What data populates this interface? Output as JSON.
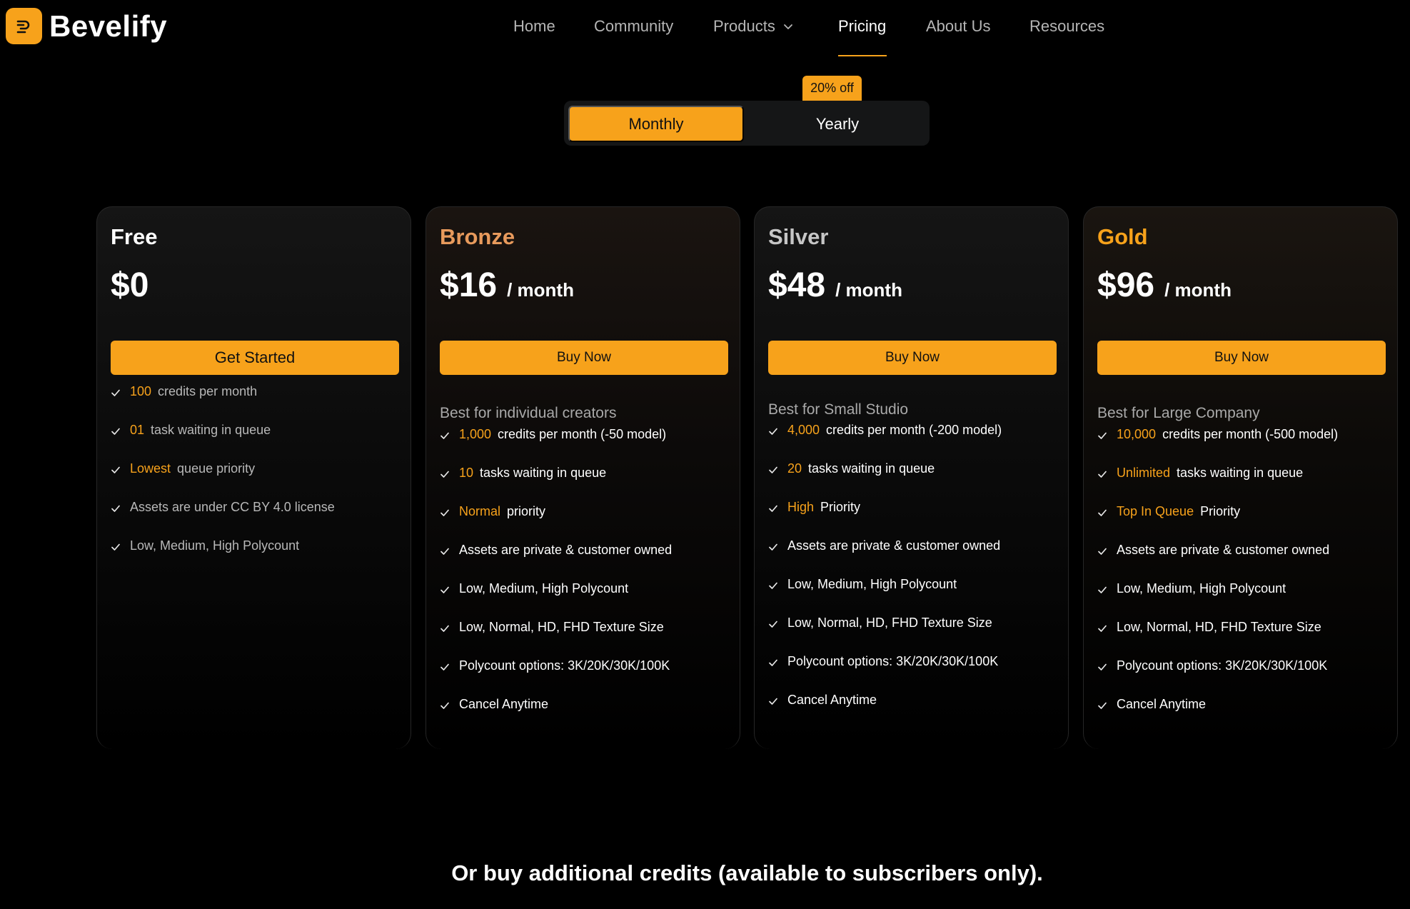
{
  "brand": {
    "name": "Bevelify",
    "accent": "#f7a21b"
  },
  "nav": {
    "items": [
      {
        "label": "Home"
      },
      {
        "label": "Community"
      },
      {
        "label": "Products"
      },
      {
        "label": "Pricing",
        "active": true
      },
      {
        "label": "About Us"
      },
      {
        "label": "Resources"
      }
    ]
  },
  "billing": {
    "discount_badge": "20% off",
    "monthly_label": "Monthly",
    "yearly_label": "Yearly",
    "selected": "Monthly"
  },
  "plans": [
    {
      "name": "Free",
      "name_color": "#ffffff",
      "price": "$0",
      "period": "",
      "button": "Get Started",
      "subtitle": "",
      "features": [
        {
          "highlight": "100",
          "text": "credits per month"
        },
        {
          "highlight": "01",
          "text": "task waiting in queue"
        },
        {
          "highlight": "Lowest",
          "text": "queue priority"
        },
        {
          "highlight": "",
          "text": "Assets are under CC BY 4.0 license"
        },
        {
          "highlight": "",
          "text": "Low, Medium, High Polycount"
        }
      ]
    },
    {
      "name": "Bronze",
      "name_color": "#e89a5c",
      "price": "$16",
      "period": "/ month",
      "button": "Buy Now",
      "subtitle": "Best for individual creators",
      "features": [
        {
          "highlight": "1,000",
          "text": "credits per month (-50 model)"
        },
        {
          "highlight": "10",
          "text": "tasks waiting in queue"
        },
        {
          "highlight": "Normal",
          "text": "priority"
        },
        {
          "highlight": "",
          "text": "Assets are private & customer owned"
        },
        {
          "highlight": "",
          "text": "Low, Medium, High Polycount"
        },
        {
          "highlight": "",
          "text": "Low, Normal, HD, FHD Texture Size"
        },
        {
          "highlight": "",
          "text": "Polycount options: 3K/20K/30K/100K"
        },
        {
          "highlight": "",
          "text": "Cancel Anytime"
        }
      ]
    },
    {
      "name": "Silver",
      "name_color": "#c6c6c6",
      "price": "$48",
      "period": "/ month",
      "button": "Buy Now",
      "subtitle": "Best for Small Studio",
      "features": [
        {
          "highlight": "4,000",
          "text": "credits per month (-200 model)"
        },
        {
          "highlight": "20",
          "text": "tasks waiting in queue"
        },
        {
          "highlight": "High",
          "text": "Priority"
        },
        {
          "highlight": "",
          "text": "Assets are private & customer owned"
        },
        {
          "highlight": "",
          "text": "Low, Medium, High Polycount"
        },
        {
          "highlight": "",
          "text": "Low, Normal, HD, FHD Texture Size"
        },
        {
          "highlight": "",
          "text": "Polycount options: 3K/20K/30K/100K"
        },
        {
          "highlight": "",
          "text": "Cancel Anytime"
        }
      ]
    },
    {
      "name": "Gold",
      "name_color": "#f7a21b",
      "price": "$96",
      "period": "/ month",
      "button": "Buy Now",
      "subtitle": "Best for Large Company",
      "features": [
        {
          "highlight": "10,000",
          "text": "credits per month (-500 model)"
        },
        {
          "highlight": "Unlimited",
          "text": "tasks waiting in queue"
        },
        {
          "highlight": "Top In Queue",
          "text": "Priority"
        },
        {
          "highlight": "",
          "text": "Assets are private & customer owned"
        },
        {
          "highlight": "",
          "text": "Low, Medium, High Polycount"
        },
        {
          "highlight": "",
          "text": "Low, Normal, HD, FHD Texture Size"
        },
        {
          "highlight": "",
          "text": "Polycount options: 3K/20K/30K/100K"
        },
        {
          "highlight": "",
          "text": "Cancel Anytime"
        }
      ]
    }
  ],
  "footer": {
    "text": "Or buy additional credits (available to subscribers only)."
  }
}
